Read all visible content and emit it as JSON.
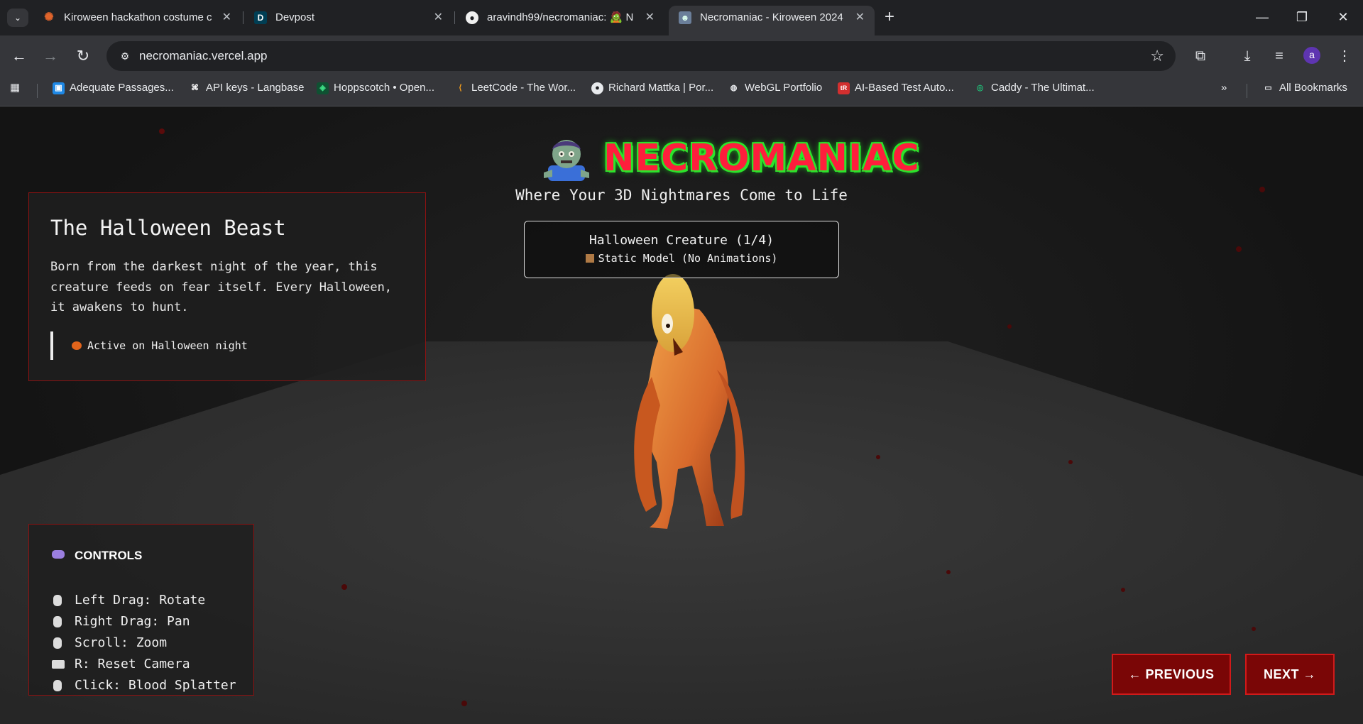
{
  "browser": {
    "tabs": [
      {
        "title": "Kiroween hackathon costume c",
        "favicon": "orange-burst-icon",
        "active": false
      },
      {
        "title": "Devpost",
        "favicon": "devpost-d-icon",
        "active": false
      },
      {
        "title": "aravindh99/necromaniac: 🧟 N",
        "favicon": "github-icon",
        "active": false
      },
      {
        "title": "Necromaniac - Kiroween 2024",
        "favicon": "zombie-icon",
        "active": true
      }
    ],
    "url": "necromaniac.vercel.app",
    "profile_initial": "a",
    "bookmarks": [
      {
        "label": "Adequate Passages...",
        "icon": "blue-square-icon"
      },
      {
        "label": "API keys - Langbase",
        "icon": "langbase-icon"
      },
      {
        "label": "Hoppscotch • Open...",
        "icon": "hoppscotch-icon"
      },
      {
        "label": "LeetCode - The Wor...",
        "icon": "leetcode-icon"
      },
      {
        "label": "Richard Mattka | Por...",
        "icon": "alien-icon"
      },
      {
        "label": "WebGL Portfolio",
        "icon": "globe-icon"
      },
      {
        "label": "AI-Based Test Auto...",
        "icon": "tr-icon"
      },
      {
        "label": "Caddy - The Ultimat...",
        "icon": "caddy-icon"
      }
    ],
    "all_bookmarks_label": "All Bookmarks"
  },
  "page": {
    "logo_text": "NECROMANIAC",
    "tagline": "Where Your 3D Nightmares Come to Life",
    "creature": {
      "title": "Halloween Creature (1/4)",
      "subtitle": "Static Model (No Animations)"
    },
    "story": {
      "title": "The Halloween Beast",
      "body": "Born from the darkest night of the year, this creature feeds on fear itself. Every Halloween, it awakens to hunt.",
      "tag": "Active on Halloween night"
    },
    "controls": {
      "title": "CONTROLS",
      "items": [
        "Left Drag: Rotate",
        "Right Drag: Pan",
        "Scroll: Zoom",
        "R: Reset Camera",
        "Click: Blood Splatter"
      ]
    },
    "prev_label": "← PREVIOUS",
    "next_label": "NEXT →"
  }
}
